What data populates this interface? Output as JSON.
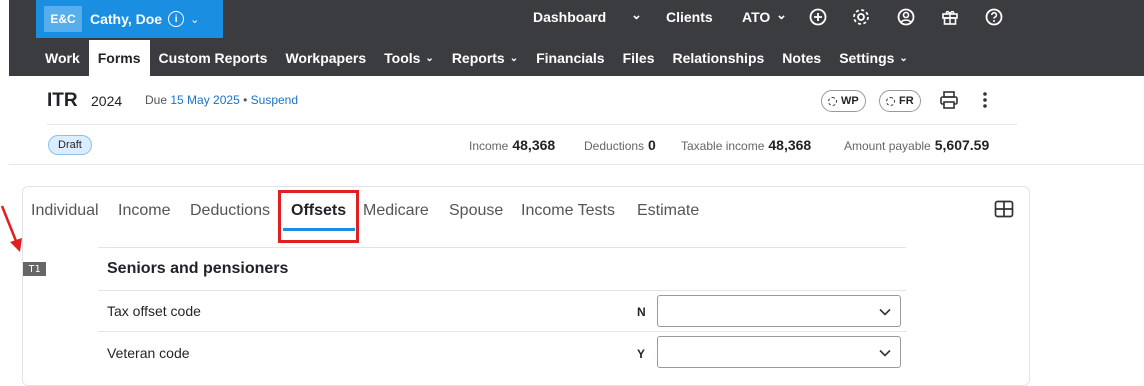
{
  "brand": {
    "badge": "E&C",
    "client_name": "Cathy, Doe"
  },
  "top_nav": {
    "dashboard": "Dashboard",
    "clients": "Clients",
    "ato": "ATO"
  },
  "sec_nav": [
    {
      "label": "Work"
    },
    {
      "label": "Forms",
      "active": true
    },
    {
      "label": "Custom Reports"
    },
    {
      "label": "Workpapers"
    },
    {
      "label": "Tools",
      "dropdown": true
    },
    {
      "label": "Reports",
      "dropdown": true
    },
    {
      "label": "Financials"
    },
    {
      "label": "Files"
    },
    {
      "label": "Relationships"
    },
    {
      "label": "Notes"
    },
    {
      "label": "Settings",
      "dropdown": true
    }
  ],
  "header": {
    "form": "ITR",
    "year": "2024",
    "due_label": "Due",
    "due_date": "15 May 2025",
    "separator": "•",
    "suspend": "Suspend",
    "wp": "WP",
    "fr": "FR"
  },
  "status": {
    "draft": "Draft"
  },
  "stats": {
    "income_label": "Income",
    "income": "48,368",
    "deductions_label": "Deductions",
    "deductions": "0",
    "taxable_label": "Taxable income",
    "taxable": "48,368",
    "payable_label": "Amount payable",
    "payable": "5,607.59"
  },
  "tabs": [
    {
      "label": "Individual"
    },
    {
      "label": "Income"
    },
    {
      "label": "Deductions"
    },
    {
      "label": "Offsets",
      "active": true
    },
    {
      "label": "Medicare"
    },
    {
      "label": "Spouse"
    },
    {
      "label": "Income Tests"
    },
    {
      "label": "Estimate"
    }
  ],
  "section": {
    "tag": "T1",
    "title": "Seniors and pensioners",
    "rows": [
      {
        "label": "Tax offset code",
        "code": "N",
        "value": ""
      },
      {
        "label": "Veteran code",
        "code": "Y",
        "value": ""
      }
    ]
  },
  "colors": {
    "nav_bg": "#3b3c40",
    "brand": "#1a8ee0",
    "highlight": "#e02020"
  }
}
